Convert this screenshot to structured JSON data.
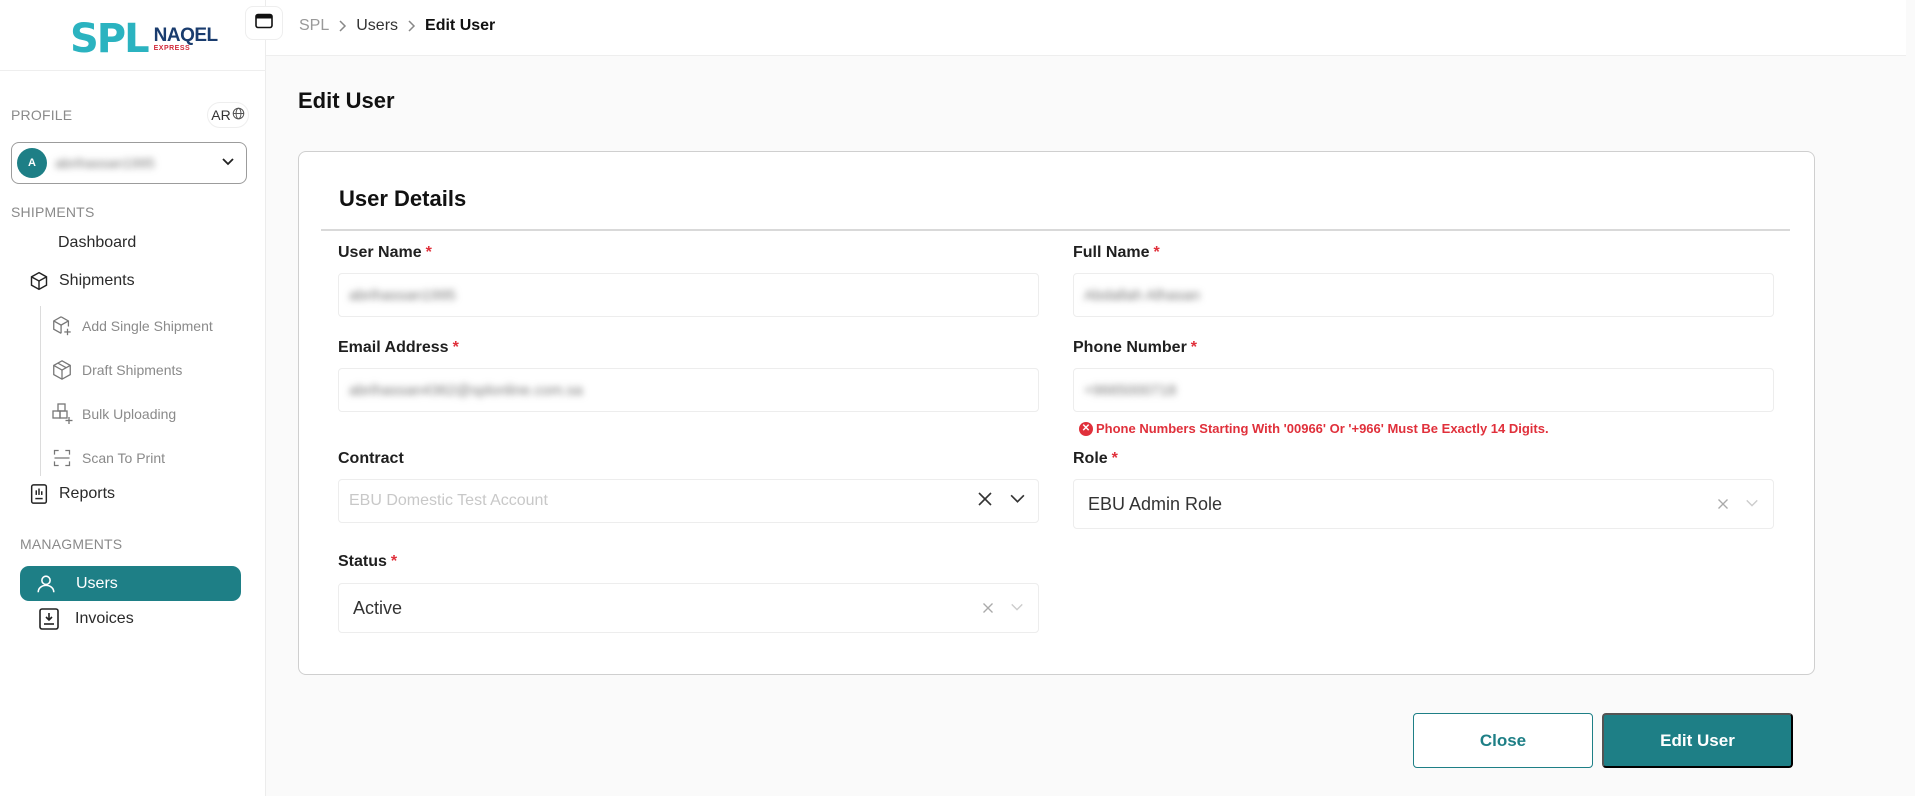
{
  "logo": {
    "spl": "SPL",
    "naqel": "NAQEL",
    "naqel_sub": "EXPRESS"
  },
  "sidebar": {
    "profile_label": "PROFILE",
    "lang_label": "AR",
    "profile": {
      "avatar_initial": "A",
      "name": "abrihassan1995"
    },
    "shipments_label": "SHIPMENTS",
    "dashboard": "Dashboard",
    "shipments": "Shipments",
    "sub_items": [
      {
        "label": "Add Single Shipment",
        "icon": "box-plus-icon"
      },
      {
        "label": "Draft Shipments",
        "icon": "box-draft-icon"
      },
      {
        "label": "Bulk Uploading",
        "icon": "boxes-plus-icon"
      },
      {
        "label": "Scan To Print",
        "icon": "scan-icon"
      }
    ],
    "reports": "Reports",
    "managements_label": "MANAGMENTS",
    "users": "Users",
    "invoices": "Invoices"
  },
  "breadcrumb": {
    "root": "SPL",
    "section": "Users",
    "current": "Edit User"
  },
  "page_title": "Edit User",
  "card": {
    "title": "User Details",
    "fields": {
      "username": {
        "label": "User Name",
        "value": "abrihassan1995"
      },
      "fullname": {
        "label": "Full Name",
        "value": "Abdallah Alhasan"
      },
      "email": {
        "label": "Email Address",
        "value": "abrihassan4362@splonline.com.sa"
      },
      "phone": {
        "label": "Phone Number",
        "value": "+9665000718"
      },
      "phone_error": "Phone Numbers Starting With '00966' Or '+966' Must Be Exactly 14 Digits.",
      "contract": {
        "label": "Contract",
        "value": "EBU Domestic Test Account"
      },
      "role": {
        "label": "Role",
        "value": "EBU Admin Role"
      },
      "status": {
        "label": "Status",
        "value": "Active"
      }
    }
  },
  "buttons": {
    "close": "Close",
    "edit": "Edit User"
  },
  "colors": {
    "primary": "#1e7f86",
    "error": "#e0303b"
  }
}
